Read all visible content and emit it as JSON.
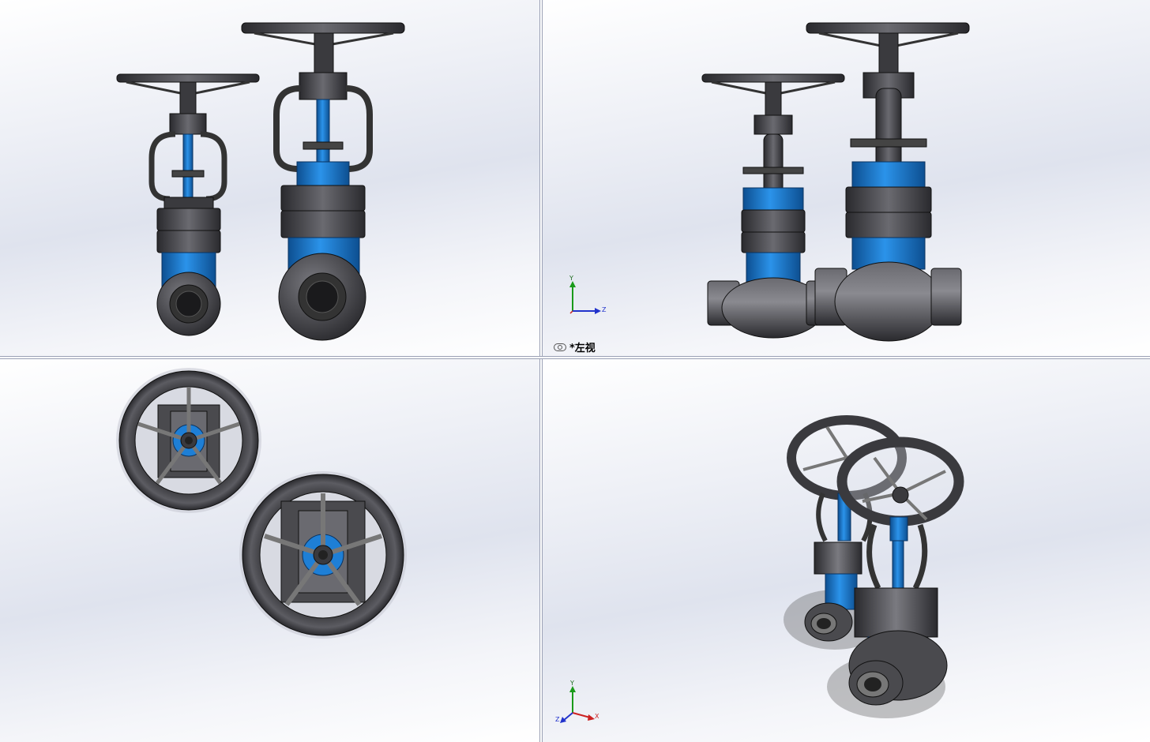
{
  "viewports": {
    "front": {
      "name": "front-view"
    },
    "left": {
      "label": "*左视",
      "triad": {
        "y": "Y",
        "z": "Z"
      }
    },
    "top": {
      "name": "top-view"
    },
    "iso": {
      "triad": {
        "y": "Y",
        "z": "Z",
        "x": "X"
      }
    }
  },
  "colors": {
    "steel": "#4a4a4e",
    "steel_dark": "#2c2c30",
    "blue": "#1e7fd6",
    "blue_dark": "#0d4f91"
  }
}
